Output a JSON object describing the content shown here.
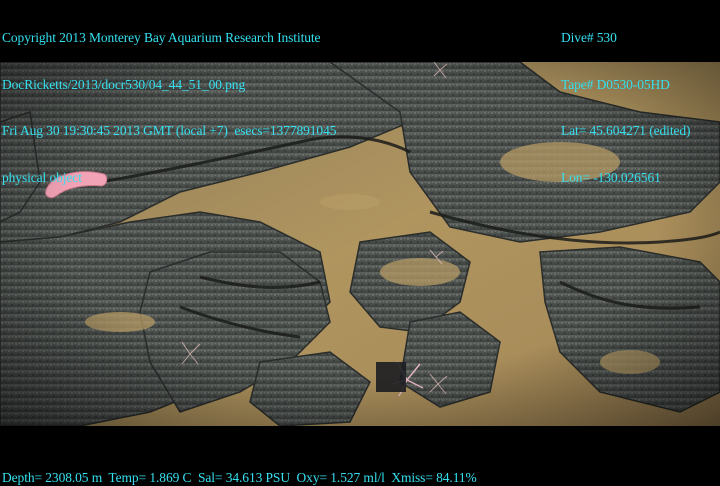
{
  "overlay": {
    "top_left": [
      "Copyright 2013 Monterey Bay Aquarium Research Institute",
      "DocRicketts/2013/docr530/04_44_51_00.png",
      "Fri Aug 30 19:30:45 2013 GMT (local +7)  esecs=1377891045",
      "physical object"
    ],
    "top_right": [
      "Dive# 530",
      "Tape# D0530-05HD",
      "Lat= 45.604271 (edited)",
      "Lon= -130.026561"
    ],
    "bottom": "Depth= 2308.05 m  Temp= 1.869 C  Sal= 34.613 PSU  Oxy= 1.527 ml/l  Xmiss= 84.11%"
  },
  "colors": {
    "overlay_text": "#34e0f0",
    "background": "#000000",
    "sediment": "#a98d5a",
    "rock": "#4e5250"
  },
  "scene": {
    "subjects": [
      "seafloor-sediment",
      "volcanic-rock",
      "pink-sea-cucumber",
      "brittle-stars"
    ]
  }
}
